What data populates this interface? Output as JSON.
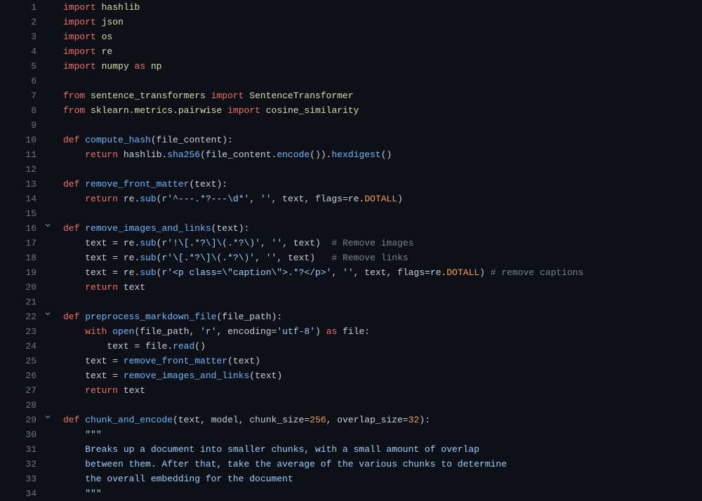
{
  "lines": [
    {
      "num": 1,
      "fold": false,
      "tokens": [
        [
          "kw",
          "import"
        ],
        [
          "op",
          " "
        ],
        [
          "mod",
          "hashlib"
        ]
      ]
    },
    {
      "num": 2,
      "fold": false,
      "tokens": [
        [
          "kw",
          "import"
        ],
        [
          "op",
          " "
        ],
        [
          "mod",
          "json"
        ]
      ]
    },
    {
      "num": 3,
      "fold": false,
      "tokens": [
        [
          "kw",
          "import"
        ],
        [
          "op",
          " "
        ],
        [
          "mod",
          "os"
        ]
      ]
    },
    {
      "num": 4,
      "fold": false,
      "tokens": [
        [
          "kw",
          "import"
        ],
        [
          "op",
          " "
        ],
        [
          "mod",
          "re"
        ]
      ]
    },
    {
      "num": 5,
      "fold": false,
      "tokens": [
        [
          "kw",
          "import"
        ],
        [
          "op",
          " "
        ],
        [
          "mod",
          "numpy"
        ],
        [
          "op",
          " "
        ],
        [
          "kw",
          "as"
        ],
        [
          "op",
          " "
        ],
        [
          "mod",
          "np"
        ]
      ]
    },
    {
      "num": 6,
      "fold": false,
      "tokens": []
    },
    {
      "num": 7,
      "fold": false,
      "tokens": [
        [
          "kw",
          "from"
        ],
        [
          "op",
          " "
        ],
        [
          "mod",
          "sentence_transformers"
        ],
        [
          "op",
          " "
        ],
        [
          "kw",
          "import"
        ],
        [
          "op",
          " "
        ],
        [
          "mod",
          "SentenceTransformer"
        ]
      ]
    },
    {
      "num": 8,
      "fold": false,
      "tokens": [
        [
          "kw",
          "from"
        ],
        [
          "op",
          " "
        ],
        [
          "mod",
          "sklearn"
        ],
        [
          "op",
          "."
        ],
        [
          "mod",
          "metrics"
        ],
        [
          "op",
          "."
        ],
        [
          "mod",
          "pairwise"
        ],
        [
          "op",
          " "
        ],
        [
          "kw",
          "import"
        ],
        [
          "op",
          " "
        ],
        [
          "mod",
          "cosine_similarity"
        ]
      ]
    },
    {
      "num": 9,
      "fold": false,
      "tokens": []
    },
    {
      "num": 10,
      "fold": false,
      "tokens": [
        [
          "kw",
          "def"
        ],
        [
          "op",
          " "
        ],
        [
          "fn",
          "compute_hash"
        ],
        [
          "op",
          "("
        ],
        [
          "param",
          "file_content"
        ],
        [
          "op",
          "):"
        ]
      ]
    },
    {
      "num": 11,
      "fold": false,
      "tokens": [
        [
          "op",
          "    "
        ],
        [
          "kw",
          "return"
        ],
        [
          "op",
          " "
        ],
        [
          "id",
          "hashlib"
        ],
        [
          "op",
          "."
        ],
        [
          "fn",
          "sha256"
        ],
        [
          "op",
          "("
        ],
        [
          "id",
          "file_content"
        ],
        [
          "op",
          "."
        ],
        [
          "fn",
          "encode"
        ],
        [
          "op",
          "())."
        ],
        [
          "fn",
          "hexdigest"
        ],
        [
          "op",
          "()"
        ]
      ]
    },
    {
      "num": 12,
      "fold": false,
      "tokens": []
    },
    {
      "num": 13,
      "fold": false,
      "tokens": [
        [
          "kw",
          "def"
        ],
        [
          "op",
          " "
        ],
        [
          "fn",
          "remove_front_matter"
        ],
        [
          "op",
          "("
        ],
        [
          "param",
          "text"
        ],
        [
          "op",
          "):"
        ]
      ]
    },
    {
      "num": 14,
      "fold": false,
      "tokens": [
        [
          "op",
          "    "
        ],
        [
          "kw",
          "return"
        ],
        [
          "op",
          " "
        ],
        [
          "id",
          "re"
        ],
        [
          "op",
          "."
        ],
        [
          "fn",
          "sub"
        ],
        [
          "op",
          "("
        ],
        [
          "str",
          "r'^---.*?---\\d*'"
        ],
        [
          "op",
          ", "
        ],
        [
          "str",
          "''"
        ],
        [
          "op",
          ", "
        ],
        [
          "id",
          "text"
        ],
        [
          "op",
          ", "
        ],
        [
          "param",
          "flags"
        ],
        [
          "op",
          "="
        ],
        [
          "id",
          "re"
        ],
        [
          "op",
          "."
        ],
        [
          "const",
          "DOTALL"
        ],
        [
          "op",
          ")"
        ]
      ]
    },
    {
      "num": 15,
      "fold": false,
      "tokens": []
    },
    {
      "num": 16,
      "fold": true,
      "tokens": [
        [
          "kw",
          "def"
        ],
        [
          "op",
          " "
        ],
        [
          "fn",
          "remove_images_and_links"
        ],
        [
          "op",
          "("
        ],
        [
          "param",
          "text"
        ],
        [
          "op",
          "):"
        ]
      ]
    },
    {
      "num": 17,
      "fold": false,
      "tokens": [
        [
          "op",
          "    "
        ],
        [
          "id",
          "text"
        ],
        [
          "op",
          " = "
        ],
        [
          "id",
          "re"
        ],
        [
          "op",
          "."
        ],
        [
          "fn",
          "sub"
        ],
        [
          "op",
          "("
        ],
        [
          "str",
          "r'!\\[.*?\\]\\(.*?\\)'"
        ],
        [
          "op",
          ", "
        ],
        [
          "str",
          "''"
        ],
        [
          "op",
          ", "
        ],
        [
          "id",
          "text"
        ],
        [
          "op",
          ")  "
        ],
        [
          "cmt",
          "# Remove images"
        ]
      ]
    },
    {
      "num": 18,
      "fold": false,
      "tokens": [
        [
          "op",
          "    "
        ],
        [
          "id",
          "text"
        ],
        [
          "op",
          " = "
        ],
        [
          "id",
          "re"
        ],
        [
          "op",
          "."
        ],
        [
          "fn",
          "sub"
        ],
        [
          "op",
          "("
        ],
        [
          "str",
          "r'\\[.*?\\]\\(.*?\\)'"
        ],
        [
          "op",
          ", "
        ],
        [
          "str",
          "''"
        ],
        [
          "op",
          ", "
        ],
        [
          "id",
          "text"
        ],
        [
          "op",
          ")   "
        ],
        [
          "cmt",
          "# Remove links"
        ]
      ]
    },
    {
      "num": 19,
      "fold": false,
      "tokens": [
        [
          "op",
          "    "
        ],
        [
          "id",
          "text"
        ],
        [
          "op",
          " = "
        ],
        [
          "id",
          "re"
        ],
        [
          "op",
          "."
        ],
        [
          "fn",
          "sub"
        ],
        [
          "op",
          "("
        ],
        [
          "str",
          "r'<p class=\\\"caption\\\">.*?</p>'"
        ],
        [
          "op",
          ", "
        ],
        [
          "str",
          "''"
        ],
        [
          "op",
          ", "
        ],
        [
          "id",
          "text"
        ],
        [
          "op",
          ", "
        ],
        [
          "param",
          "flags"
        ],
        [
          "op",
          "="
        ],
        [
          "id",
          "re"
        ],
        [
          "op",
          "."
        ],
        [
          "const",
          "DOTALL"
        ],
        [
          "op",
          ") "
        ],
        [
          "cmt",
          "# remove captions"
        ]
      ]
    },
    {
      "num": 20,
      "fold": false,
      "tokens": [
        [
          "op",
          "    "
        ],
        [
          "kw",
          "return"
        ],
        [
          "op",
          " "
        ],
        [
          "id",
          "text"
        ]
      ]
    },
    {
      "num": 21,
      "fold": false,
      "tokens": []
    },
    {
      "num": 22,
      "fold": true,
      "tokens": [
        [
          "kw",
          "def"
        ],
        [
          "op",
          " "
        ],
        [
          "fn",
          "preprocess_markdown_file"
        ],
        [
          "op",
          "("
        ],
        [
          "param",
          "file_path"
        ],
        [
          "op",
          "):"
        ]
      ]
    },
    {
      "num": 23,
      "fold": false,
      "tokens": [
        [
          "op",
          "    "
        ],
        [
          "kw",
          "with"
        ],
        [
          "op",
          " "
        ],
        [
          "fn",
          "open"
        ],
        [
          "op",
          "("
        ],
        [
          "id",
          "file_path"
        ],
        [
          "op",
          ", "
        ],
        [
          "str",
          "'r'"
        ],
        [
          "op",
          ", "
        ],
        [
          "param",
          "encoding"
        ],
        [
          "op",
          "="
        ],
        [
          "str",
          "'utf-8'"
        ],
        [
          "op",
          ") "
        ],
        [
          "kw",
          "as"
        ],
        [
          "op",
          " "
        ],
        [
          "id",
          "file"
        ],
        [
          "op",
          ":"
        ]
      ]
    },
    {
      "num": 24,
      "fold": false,
      "tokens": [
        [
          "op",
          "        "
        ],
        [
          "id",
          "text"
        ],
        [
          "op",
          " = "
        ],
        [
          "id",
          "file"
        ],
        [
          "op",
          "."
        ],
        [
          "fn",
          "read"
        ],
        [
          "op",
          "()"
        ]
      ]
    },
    {
      "num": 25,
      "fold": false,
      "tokens": [
        [
          "op",
          "    "
        ],
        [
          "id",
          "text"
        ],
        [
          "op",
          " = "
        ],
        [
          "fn",
          "remove_front_matter"
        ],
        [
          "op",
          "("
        ],
        [
          "id",
          "text"
        ],
        [
          "op",
          ")"
        ]
      ]
    },
    {
      "num": 26,
      "fold": false,
      "tokens": [
        [
          "op",
          "    "
        ],
        [
          "id",
          "text"
        ],
        [
          "op",
          " = "
        ],
        [
          "fn",
          "remove_images_and_links"
        ],
        [
          "op",
          "("
        ],
        [
          "id",
          "text"
        ],
        [
          "op",
          ")"
        ]
      ]
    },
    {
      "num": 27,
      "fold": false,
      "tokens": [
        [
          "op",
          "    "
        ],
        [
          "kw",
          "return"
        ],
        [
          "op",
          " "
        ],
        [
          "id",
          "text"
        ]
      ]
    },
    {
      "num": 28,
      "fold": false,
      "tokens": []
    },
    {
      "num": 29,
      "fold": true,
      "tokens": [
        [
          "kw",
          "def"
        ],
        [
          "op",
          " "
        ],
        [
          "fn",
          "chunk_and_encode"
        ],
        [
          "op",
          "("
        ],
        [
          "param",
          "text"
        ],
        [
          "op",
          ", "
        ],
        [
          "param",
          "model"
        ],
        [
          "op",
          ", "
        ],
        [
          "param",
          "chunk_size"
        ],
        [
          "op",
          "="
        ],
        [
          "num",
          "256"
        ],
        [
          "op",
          ", "
        ],
        [
          "param",
          "overlap_size"
        ],
        [
          "op",
          "="
        ],
        [
          "num",
          "32"
        ],
        [
          "op",
          "):"
        ]
      ]
    },
    {
      "num": 30,
      "fold": false,
      "tokens": [
        [
          "op",
          "    "
        ],
        [
          "str",
          "\"\"\""
        ]
      ]
    },
    {
      "num": 31,
      "fold": false,
      "tokens": [
        [
          "str",
          "    Breaks up a document into smaller chunks, with a small amount of overlap"
        ]
      ]
    },
    {
      "num": 32,
      "fold": false,
      "tokens": [
        [
          "str",
          "    between them. After that, take the average of the various chunks to determine"
        ]
      ]
    },
    {
      "num": 33,
      "fold": false,
      "tokens": [
        [
          "str",
          "    the overall embedding for the document"
        ]
      ]
    },
    {
      "num": 34,
      "fold": false,
      "tokens": [
        [
          "op",
          "    "
        ],
        [
          "str",
          "\"\"\""
        ]
      ]
    }
  ]
}
